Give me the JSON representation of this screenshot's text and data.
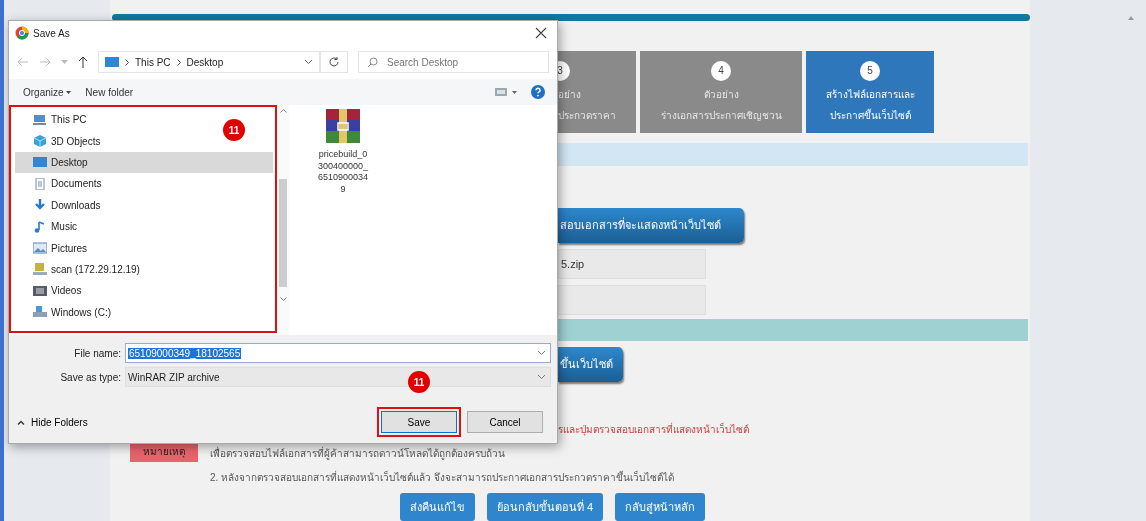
{
  "page": {
    "steps": [
      {
        "number": "3",
        "lines": [
          "อย่าง",
          "ประกวดราคา"
        ],
        "selected": false
      },
      {
        "number": "4",
        "lines": [
          "ตัวอย่าง",
          "ร่างเอกสารประกาศเชิญชวน"
        ],
        "selected": false
      },
      {
        "number": "5",
        "lines": [
          "สร้างไฟล์เอกสารและ",
          "ประกาศขึ้นเว็บไซต์"
        ],
        "selected": true
      }
    ],
    "check_button": "สอบเอกสารที่จะแสดงหน้าเว็บไซต์",
    "zip_field": "5.zip",
    "publish_button": "ขึ้นเว็บไซต์",
    "note_label": "หมายเหตุ",
    "note_warning": "รและปุ่มตรวจสอบเอกสารที่แสดงหน้าเว็บไซต์",
    "note_lines": [
      "เพื่อตรวจสอบไฟล์เอกสารที่ผู้ค้าสามารถดาวน์โหลดได้ถูกต้องครบถ้วน",
      "2. หลังจากตรวจสอบเอกสารที่แสดงหน้าเว็บไซต์แล้ว จึงจะสามารถประกาศเอกสารประกวดราคาขึ้นเว็บไซต์ได้"
    ],
    "bottom_buttons": [
      "ส่งคืนแก้ไข",
      "ย้อนกลับขั้นตอนที่ 4",
      "กลับสู่หน้าหลัก"
    ]
  },
  "dialog": {
    "title": "Save As",
    "breadcrumb": [
      "This PC",
      "Desktop"
    ],
    "search": {
      "placeholder": "Search Desktop"
    },
    "toolbar": [
      "Organize",
      "New folder"
    ],
    "nav_callout": "11",
    "nav_items": [
      {
        "label": "This PC",
        "kind": "pc",
        "selected": false
      },
      {
        "label": "3D Objects",
        "kind": "cube",
        "selected": false
      },
      {
        "label": "Desktop",
        "kind": "desktop",
        "selected": true
      },
      {
        "label": "Documents",
        "kind": "document",
        "selected": false
      },
      {
        "label": "Downloads",
        "kind": "download",
        "selected": false
      },
      {
        "label": "Music",
        "kind": "music",
        "selected": false
      },
      {
        "label": "Pictures",
        "kind": "pictures",
        "selected": false
      },
      {
        "label": "scan (172.29.12.19)",
        "kind": "network",
        "selected": false
      },
      {
        "label": "Videos",
        "kind": "videos",
        "selected": false
      },
      {
        "label": "Windows (C:)",
        "kind": "drive",
        "selected": false
      }
    ],
    "files": [
      {
        "name": "pricebuild_0300400000_65109000349"
      }
    ],
    "file_name_label": "File name:",
    "file_name": "65109000349_18102565",
    "type_label": "Save as type:",
    "save_as_type": "WinRAR ZIP archive",
    "hide_folders": "Hide Folders",
    "buttons": [
      {
        "label": "Save",
        "callout": "11"
      },
      {
        "label": "Cancel"
      }
    ]
  }
}
